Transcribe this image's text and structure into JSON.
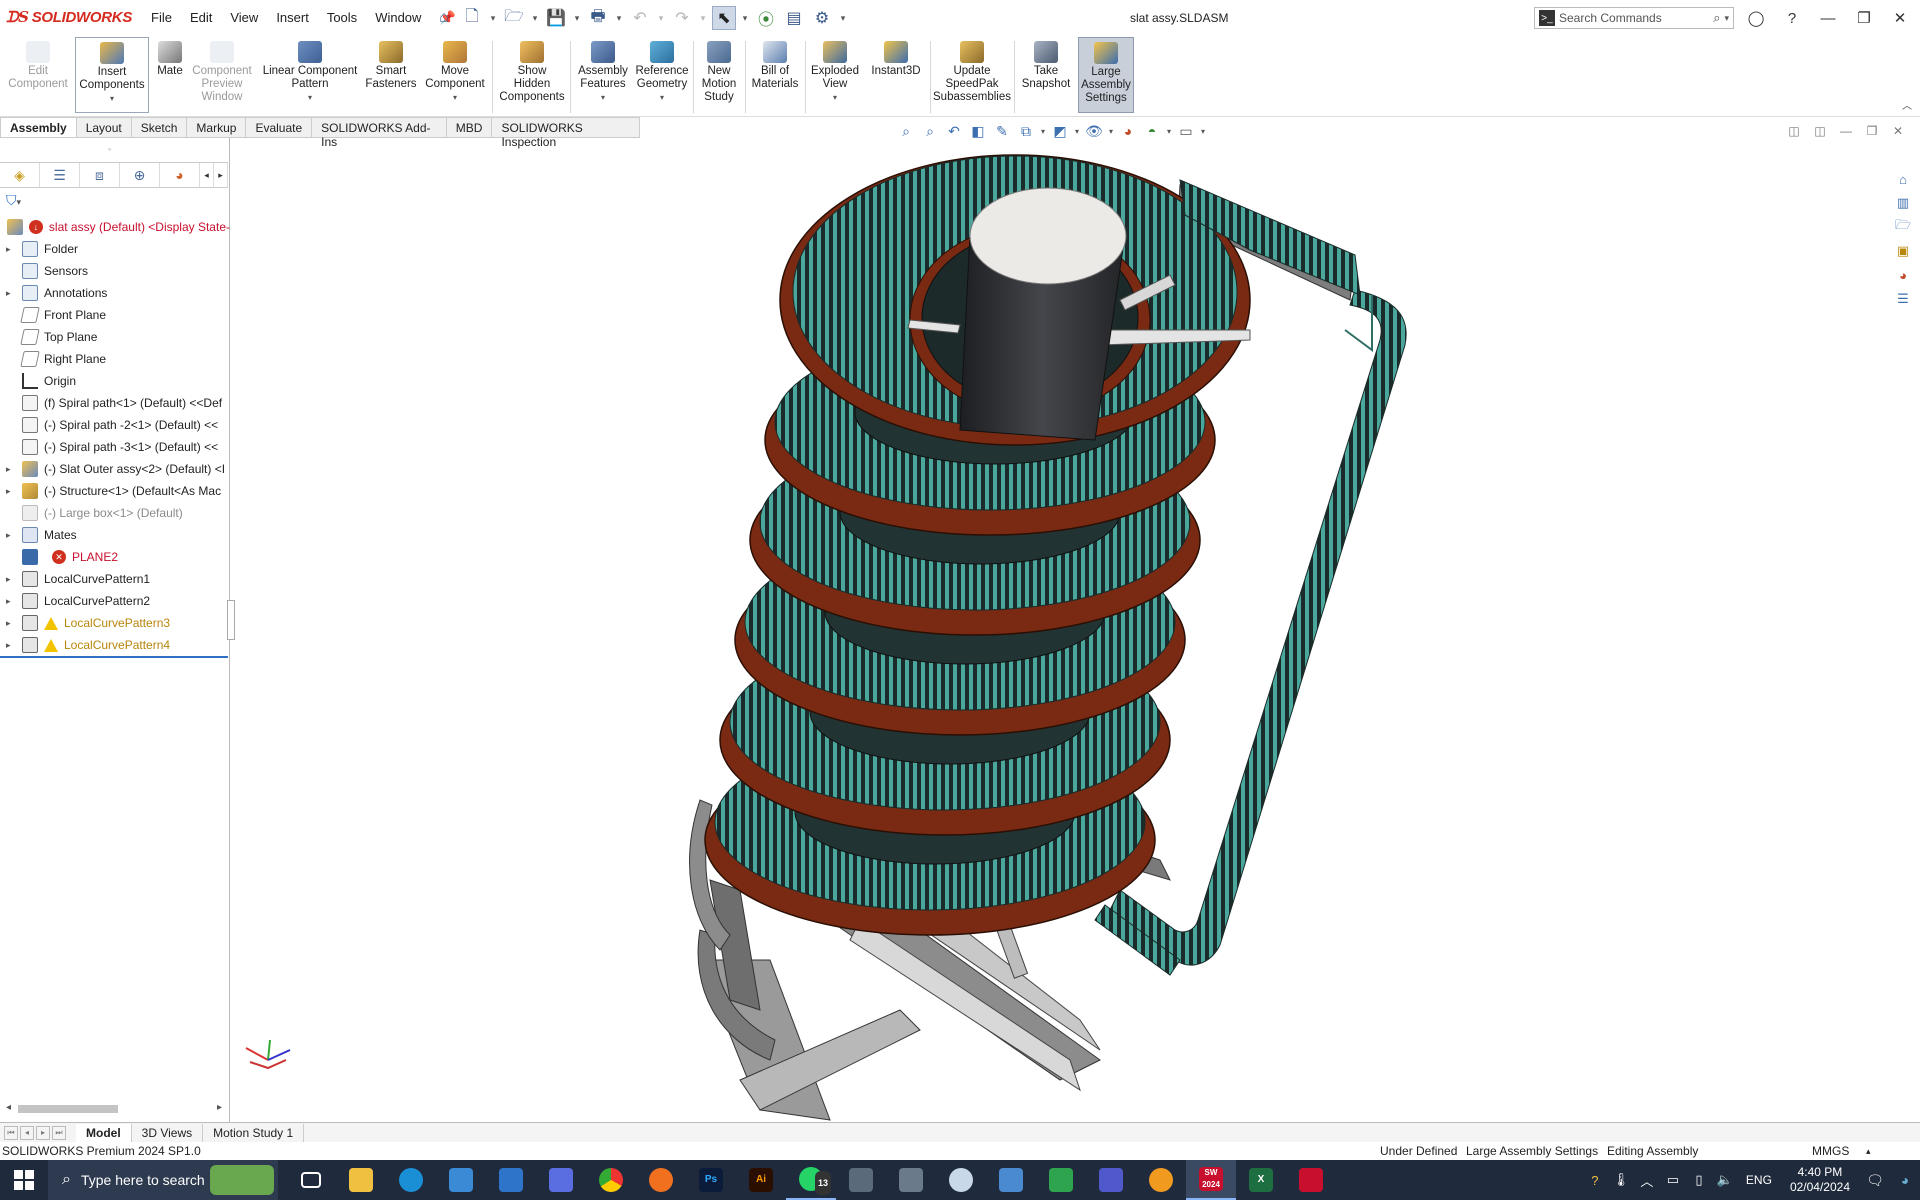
{
  "app": {
    "logo": "SOLIDWORKS",
    "document_title": "slat assy.SLDASM"
  },
  "menu": [
    "File",
    "Edit",
    "View",
    "Insert",
    "Tools",
    "Window"
  ],
  "search": {
    "placeholder": "Search Commands"
  },
  "commands": [
    {
      "label": "Edit\nComponent",
      "enabled": false
    },
    {
      "label": "Insert\nComponents",
      "enabled": true
    },
    {
      "label": "Mate",
      "enabled": true
    },
    {
      "label": "Component\nPreview\nWindow",
      "enabled": false
    },
    {
      "label": "Linear Component\nPattern",
      "enabled": true
    },
    {
      "label": "Smart\nFasteners",
      "enabled": true
    },
    {
      "label": "Move\nComponent",
      "enabled": true
    },
    {
      "label": "Show\nHidden\nComponents",
      "enabled": true
    },
    {
      "label": "Assembly\nFeatures",
      "enabled": true
    },
    {
      "label": "Reference\nGeometry",
      "enabled": true
    },
    {
      "label": "New\nMotion\nStudy",
      "enabled": true
    },
    {
      "label": "Bill of\nMaterials",
      "enabled": true
    },
    {
      "label": "Exploded\nView",
      "enabled": true
    },
    {
      "label": "Instant3D",
      "enabled": true
    },
    {
      "label": "Update\nSpeedPak\nSubassemblies",
      "enabled": true
    },
    {
      "label": "Take\nSnapshot",
      "enabled": true
    },
    {
      "label": "Large\nAssembly\nSettings",
      "enabled": true,
      "active": true
    }
  ],
  "tabs": [
    "Assembly",
    "Layout",
    "Sketch",
    "Markup",
    "Evaluate",
    "SOLIDWORKS Add-Ins",
    "MBD",
    "SOLIDWORKS Inspection"
  ],
  "active_tab": "Assembly",
  "tree": [
    {
      "label": "slat assy (Default) <Display State-",
      "style": "red",
      "expand": false,
      "badge": "error-circle"
    },
    {
      "label": "Folder",
      "expand": true
    },
    {
      "label": "Sensors",
      "expand": false
    },
    {
      "label": "Annotations",
      "expand": true
    },
    {
      "label": "Front Plane",
      "expand": false
    },
    {
      "label": "Top Plane",
      "expand": false
    },
    {
      "label": "Right Plane",
      "expand": false
    },
    {
      "label": "Origin",
      "expand": false
    },
    {
      "label": "(f) Spiral path<1> (Default) <<Def",
      "expand": false
    },
    {
      "label": "(-) Spiral path -2<1> (Default) <<",
      "expand": false
    },
    {
      "label": "(-) Spiral path -3<1> (Default) <<",
      "expand": false
    },
    {
      "label": "(-) Slat Outer assy<2> (Default) <I",
      "expand": true
    },
    {
      "label": "(-) Structure<1> (Default<As Mac",
      "expand": true
    },
    {
      "label": "(-) Large box<1> (Default)",
      "style": "grey",
      "expand": false
    },
    {
      "label": "Mates",
      "expand": true
    },
    {
      "label": "PLANE2",
      "style": "red",
      "expand": false,
      "badge": "error-x"
    },
    {
      "label": "LocalCurvePattern1",
      "expand": true
    },
    {
      "label": "LocalCurvePattern2",
      "expand": true
    },
    {
      "label": "LocalCurvePattern3",
      "style": "warn",
      "expand": true,
      "badge": "warning"
    },
    {
      "label": "LocalCurvePattern4",
      "style": "warn",
      "expand": true,
      "badge": "warning"
    }
  ],
  "bottom_tabs": [
    "Model",
    "3D Views",
    "Motion Study 1"
  ],
  "status": {
    "product": "SOLIDWORKS Premium 2024 SP1.0",
    "definition": "Under Defined",
    "large_assembly": "Large Assembly Settings",
    "mode": "Editing Assembly",
    "units": "MMGS"
  },
  "taskbar": {
    "search_placeholder": "Type here to search",
    "whatsapp_badge": "13",
    "lang": "ENG",
    "time": "4:40 PM",
    "date": "02/04/2024"
  },
  "colors": {
    "belt": "#7a2a12",
    "slats": "#3f8f86",
    "frame": "#8a8a8a",
    "core": "#2e2f33"
  }
}
